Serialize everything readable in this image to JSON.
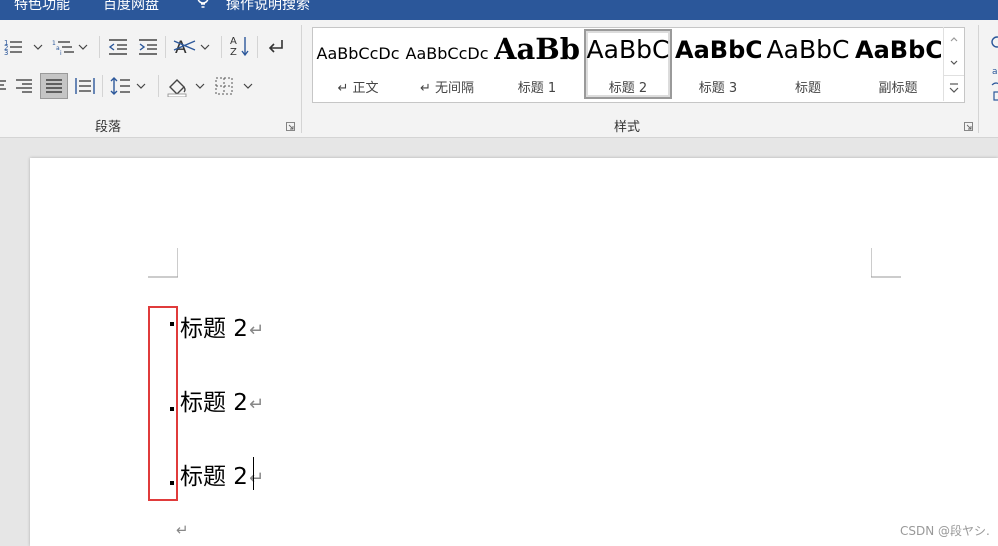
{
  "menu": {
    "items": [
      {
        "label": "特色功能"
      },
      {
        "label": "百度网盘"
      },
      {
        "label": "操作说明搜索"
      }
    ]
  },
  "ribbon": {
    "paragraph_group": {
      "label": "段落"
    },
    "styles_group": {
      "label": "样式",
      "items": [
        {
          "preview": "AaBbCcDc",
          "name": "↵ 正文",
          "selected": false
        },
        {
          "preview": "AaBbCcDc",
          "name": "↵ 无间隔",
          "selected": false
        },
        {
          "preview": "AaBb",
          "name": "标题 1",
          "selected": false
        },
        {
          "preview": "AaBbC",
          "name": "标题 2",
          "selected": true
        },
        {
          "preview": "AaBbC",
          "name": "标题 3",
          "selected": false
        },
        {
          "preview": "AaBbC",
          "name": "标题",
          "selected": false
        },
        {
          "preview": "AaBbC",
          "name": "副标题",
          "selected": false
        }
      ]
    }
  },
  "document": {
    "lines": [
      {
        "text": "标题 2",
        "mark": "↵"
      },
      {
        "text": "标题 2",
        "mark": "↵"
      },
      {
        "text": "标题 2",
        "mark": "↵"
      }
    ],
    "empty_mark": "↵"
  },
  "watermark": "CSDN @段ヤシ.",
  "colors": {
    "titlebar": "#2b579a",
    "highlight": "#e03b3b"
  }
}
